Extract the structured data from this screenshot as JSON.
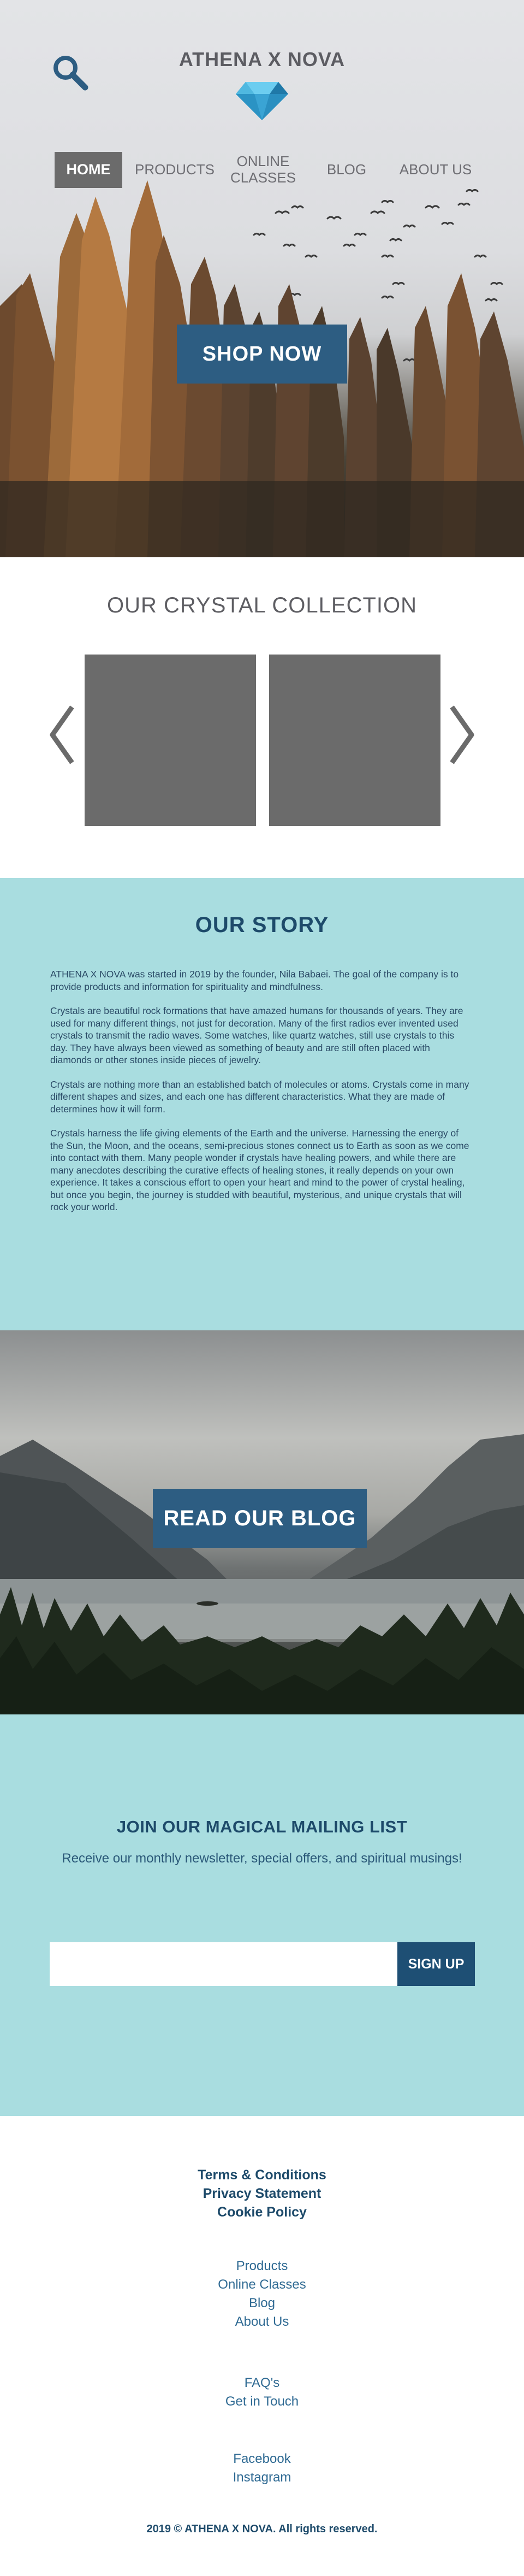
{
  "header": {
    "brand": "ATHENA X NOVA",
    "search_icon": "search-icon",
    "logo_icon": "diamond-icon",
    "nav": [
      {
        "label": "HOME",
        "active": true
      },
      {
        "label": "PRODUCTS",
        "active": false
      },
      {
        "label": "ONLINE\nCLASSES",
        "active": false
      },
      {
        "label": "BLOG",
        "active": false
      },
      {
        "label": "ABOUT US",
        "active": false
      }
    ],
    "cta": "SHOP NOW"
  },
  "collection": {
    "title": "OUR CRYSTAL COLLECTION",
    "prev_icon": "chevron-left-icon",
    "next_icon": "chevron-right-icon",
    "card_count_visible": 2
  },
  "story": {
    "title": "OUR STORY",
    "paragraphs": [
      "ATHENA X NOVA was started in 2019 by the founder, Nila Babaei. The goal of the company is to provide products and information for spirituality and mindfulness.",
      "Crystals are beautiful rock formations that have amazed humans for thousands of years. They are used for many different things, not just for decoration. Many of the first radios ever invented used crystals to transmit the radio waves. Some watches, like quartz watches, still use crystals to this day. They have always been viewed as something of beauty and are still often placed with diamonds or other stones inside pieces of jewelry.",
      "Crystals are nothing more than an established batch of molecules or atoms. Crystals come in many different shapes and sizes, and each one has different characteristics. What they are made of determines how it will form.",
      "Crystals harness the life giving elements of the Earth and the universe. Harnessing the energy of the Sun, the Moon, and the oceans, semi-precious stones connect us to Earth as soon as we come into contact with them. Many people wonder if crystals have healing powers, and while there are many anecdotes describing the curative effects of healing stones, it really depends on your own experience. It takes a conscious effort to open your heart and mind to the power of crystal healing, but once you begin, the journey is studded with beautiful, mysterious, and unique crystals that will rock your world."
    ]
  },
  "blog": {
    "cta": "READ OUR BLOG"
  },
  "mailing": {
    "title": "JOIN OUR MAGICAL MAILING LIST",
    "subtitle": "Receive our monthly newsletter, special offers, and spiritual musings!",
    "email_value": "",
    "button": "SIGN UP"
  },
  "footer": {
    "legal": [
      "Terms & Conditions",
      "Privacy Statement",
      "Cookie Policy"
    ],
    "site": [
      "Products",
      "Online Classes",
      "Blog",
      "About Us"
    ],
    "help": [
      "FAQ's",
      "Get in Touch"
    ],
    "social": [
      "Facebook",
      "Instagram"
    ],
    "copyright": "2019  © ATHENA X NOVA. All rights reserved."
  },
  "colors": {
    "accent": "#2d5d82",
    "navy": "#1d4a6a",
    "teal_bg": "#a9dde0",
    "gray_card": "#6b6b6b"
  }
}
